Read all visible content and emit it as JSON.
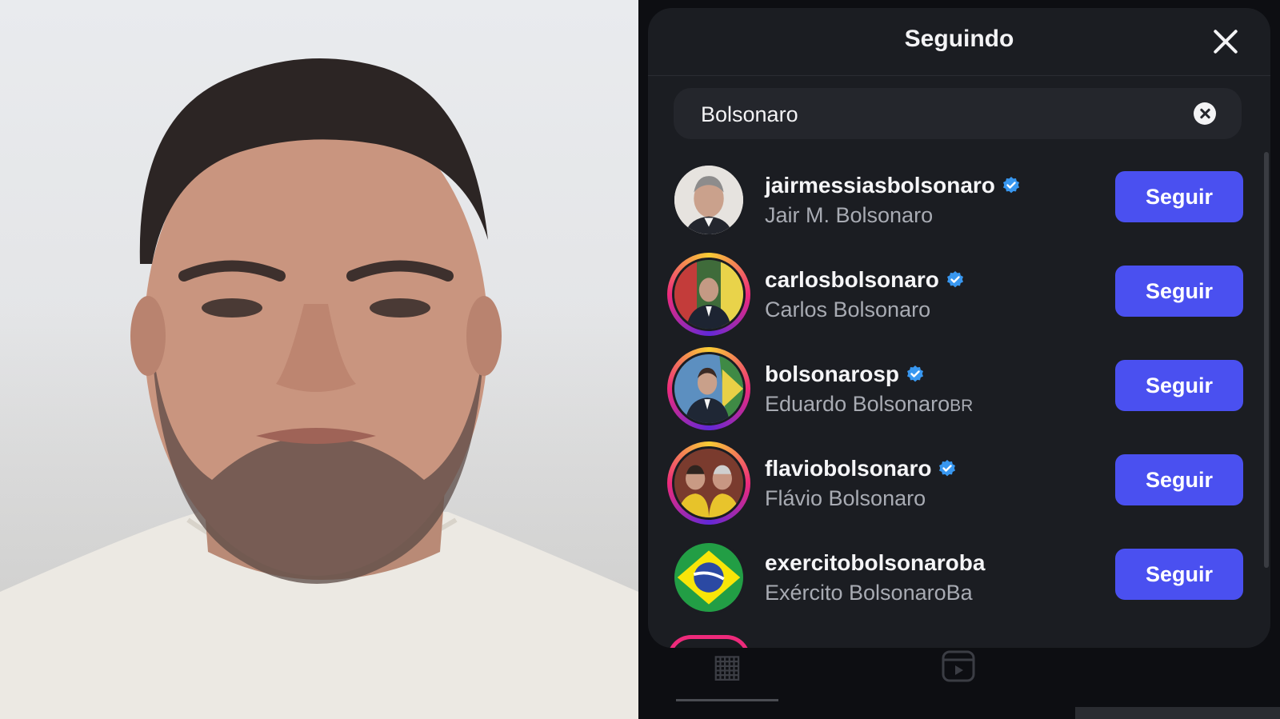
{
  "modal": {
    "title": "Seguindo",
    "close_icon": "close-icon"
  },
  "search": {
    "value": "Bolsonaro",
    "clear_icon": "clear-icon"
  },
  "accounts": [
    {
      "username": "jairmessiasbolsonaro",
      "name": "Jair M. Bolsonaro",
      "verified": true,
      "button": "Seguir",
      "story_ring": false
    },
    {
      "username": "carlosbolsonaro",
      "name": "Carlos Bolsonaro",
      "verified": true,
      "button": "Seguir",
      "story_ring": true
    },
    {
      "username": "bolsonarosp",
      "name": "Eduardo Bolsonaro",
      "name_suffix": "BR",
      "verified": true,
      "button": "Seguir",
      "story_ring": true
    },
    {
      "username": "flaviobolsonaro",
      "name": "Flávio Bolsonaro",
      "verified": true,
      "button": "Seguir",
      "story_ring": true
    },
    {
      "username": "exercitobolsonaroba",
      "name": "Exército BolsonaroBa",
      "verified": false,
      "button": "Seguir",
      "story_ring": false
    }
  ],
  "colors": {
    "follow_button": "#4a50f0",
    "verified_badge": "#3897f0",
    "modal_bg": "#1b1d22"
  }
}
